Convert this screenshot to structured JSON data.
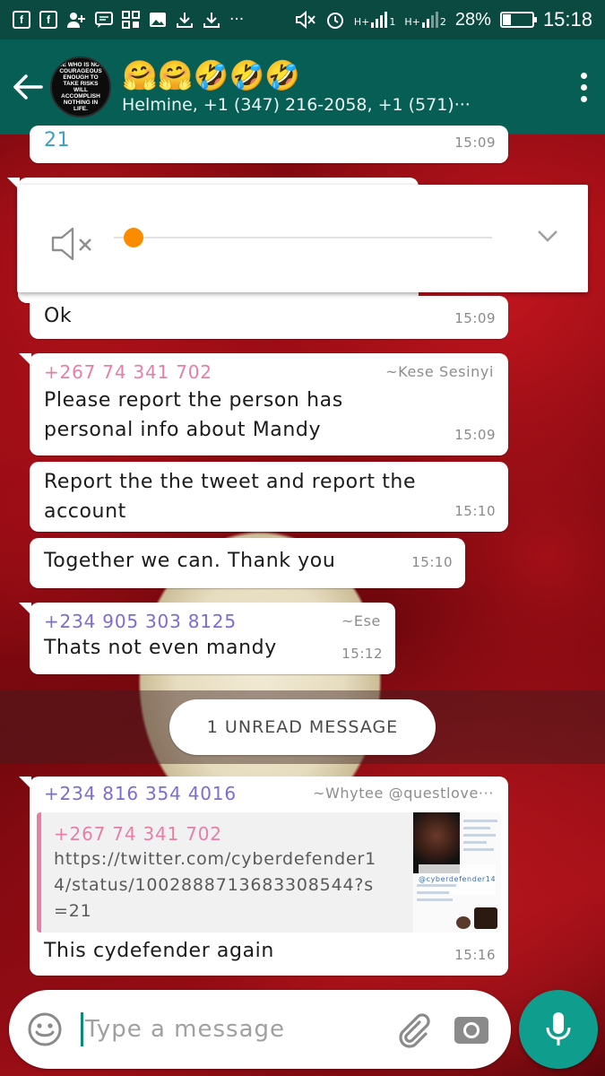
{
  "status_bar": {
    "battery": "28%",
    "battery_level": 0.28,
    "time": "15:18",
    "ellipsis": "···",
    "network_1": "H+",
    "network_2": "H+",
    "sim_1": "1",
    "sim_2": "2"
  },
  "header": {
    "avatar_text": "HE WHO IS NOT COURAGEOUS ENOUGH TO TAKE RISKS WILL ACCOMPLISH NOTHING IN LIFE.",
    "title": "🤗🤗🤣🤣🤣",
    "subtitle": "Helmine, +1 (347) 216-2058, +1 (571)···"
  },
  "audio_player": {
    "progress": 0.0,
    "mute_icon": "speaker-muted-icon",
    "chevron_icon": "chevron-down-icon"
  },
  "messages": [
    {
      "text": "21",
      "time": "15:09"
    },
    {
      "text": "Ok",
      "time": "15:09"
    },
    {
      "sender_number": "+267 74 341 702",
      "sender_name": "~Kese Sesinyi",
      "text": "Please report the person has personal info about Mandy",
      "time": "15:09"
    },
    {
      "text": "Report the the tweet and report the account",
      "time": "15:10"
    },
    {
      "text": "Together we can. Thank you",
      "time": "15:10"
    },
    {
      "sender_number": "+234 905 303 8125",
      "sender_name": "~Ese",
      "text": "Thats not even mandy",
      "time": "15:12"
    },
    {
      "sender_number": "+234 816 354 4016",
      "sender_name": "~Whytee @questlove···",
      "quote_number": "+267 74 341 702",
      "quote_text": "https://twitter.com/cyberdefender14/status/1002888713683308544?s=21",
      "thumb_tag": "@cyberdefender14",
      "text": "This cydefender again",
      "time": "15:16"
    }
  ],
  "unread_banner": "1 UNREAD MESSAGE",
  "composer": {
    "placeholder": "Type a message"
  },
  "colors": {
    "header": "#075e54",
    "status": "#0b4a41",
    "sender_pink": "#e57fa6",
    "sender_purple": "#7e6bd6",
    "mic": "#0f9d8e",
    "slider": "#fb8c00"
  }
}
